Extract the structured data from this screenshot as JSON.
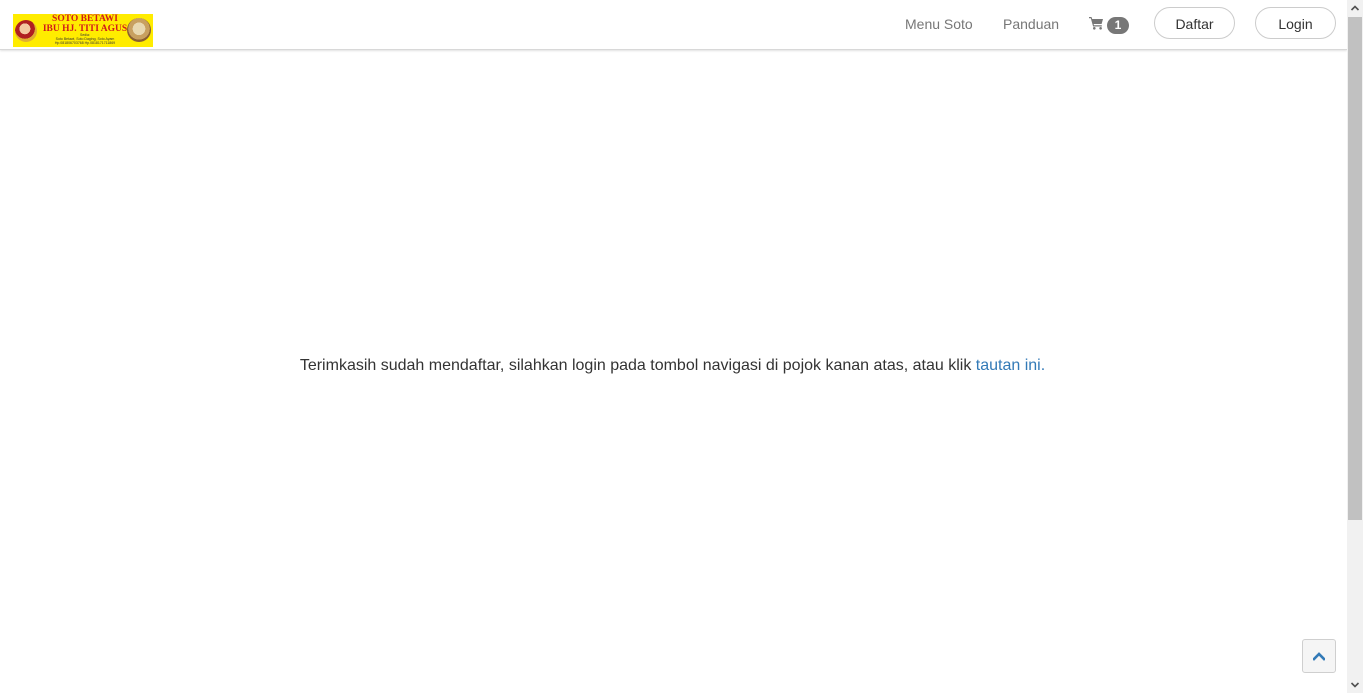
{
  "logo": {
    "title_line1": "SOTO BETAWI",
    "title_line2": "IBU HJ. TITI AGUS",
    "sub_line1": "Sedia:",
    "sub_line2": "Soto Betawi, Soto Daging, Soto Ayam",
    "sub_line3": "Hp.081806703768  Hp.0818171711869"
  },
  "nav": {
    "menu_soto": "Menu Soto",
    "panduan": "Panduan",
    "cart_count": "1",
    "daftar": "Daftar",
    "login": "Login"
  },
  "main": {
    "message": "Terimkasih sudah mendaftar, silahkan login pada tombol navigasi di pojok kanan atas, atau klik ",
    "link_text": "tautan ini."
  },
  "colors": {
    "link": "#337ab7",
    "nav_text": "#777777",
    "badge_bg": "#777777"
  }
}
